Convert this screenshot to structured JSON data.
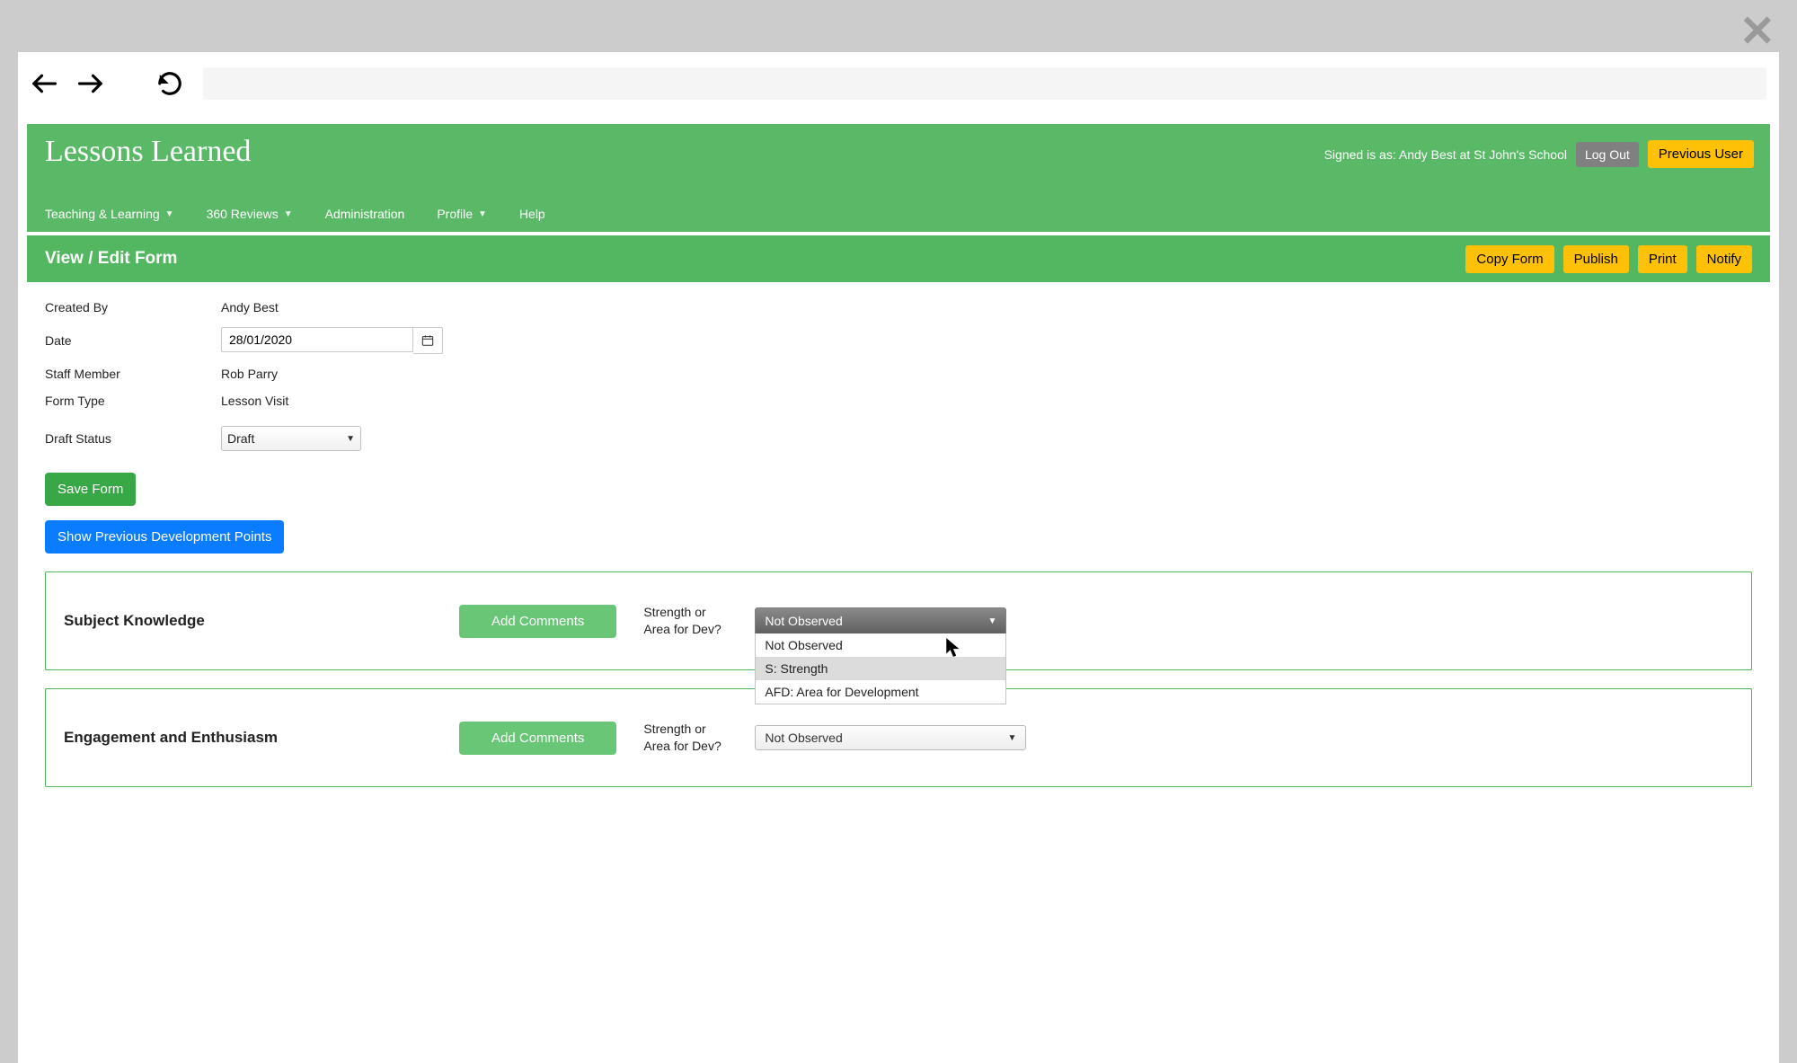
{
  "browser": {
    "close_label": "✕"
  },
  "header": {
    "brand": "Lessons Learned",
    "signed_in": "Signed is as: Andy Best at St John's School",
    "logout": "Log Out",
    "previous_user": "Previous User",
    "nav": [
      {
        "label": "Teaching & Learning",
        "caret": true
      },
      {
        "label": "360 Reviews",
        "caret": true
      },
      {
        "label": "Administration",
        "caret": false
      },
      {
        "label": "Profile",
        "caret": true
      },
      {
        "label": "Help",
        "caret": false
      }
    ]
  },
  "subbar": {
    "title": "View / Edit Form",
    "actions": [
      "Copy Form",
      "Publish",
      "Print",
      "Notify"
    ]
  },
  "form": {
    "created_by": {
      "label": "Created By",
      "value": "Andy Best"
    },
    "date": {
      "label": "Date",
      "value": "28/01/2020"
    },
    "staff": {
      "label": "Staff Member",
      "value": "Rob Parry"
    },
    "form_type": {
      "label": "Form Type",
      "value": "Lesson Visit"
    },
    "draft_status": {
      "label": "Draft Status",
      "value": "Draft"
    },
    "save_form": "Save Form",
    "show_prev": "Show Previous Development Points"
  },
  "sections": [
    {
      "title": "Subject Knowledge",
      "add_comments": "Add Comments",
      "sa_label": "Strength or Area for Dev?",
      "selected": "Not Observed",
      "open": true,
      "options": [
        "Not Observed",
        "S: Strength",
        "AFD: Area for Development"
      ]
    },
    {
      "title": "Engagement and Enthusiasm",
      "add_comments": "Add Comments",
      "sa_label": "Strength or Area for Dev?",
      "selected": "Not Observed",
      "open": false
    }
  ]
}
